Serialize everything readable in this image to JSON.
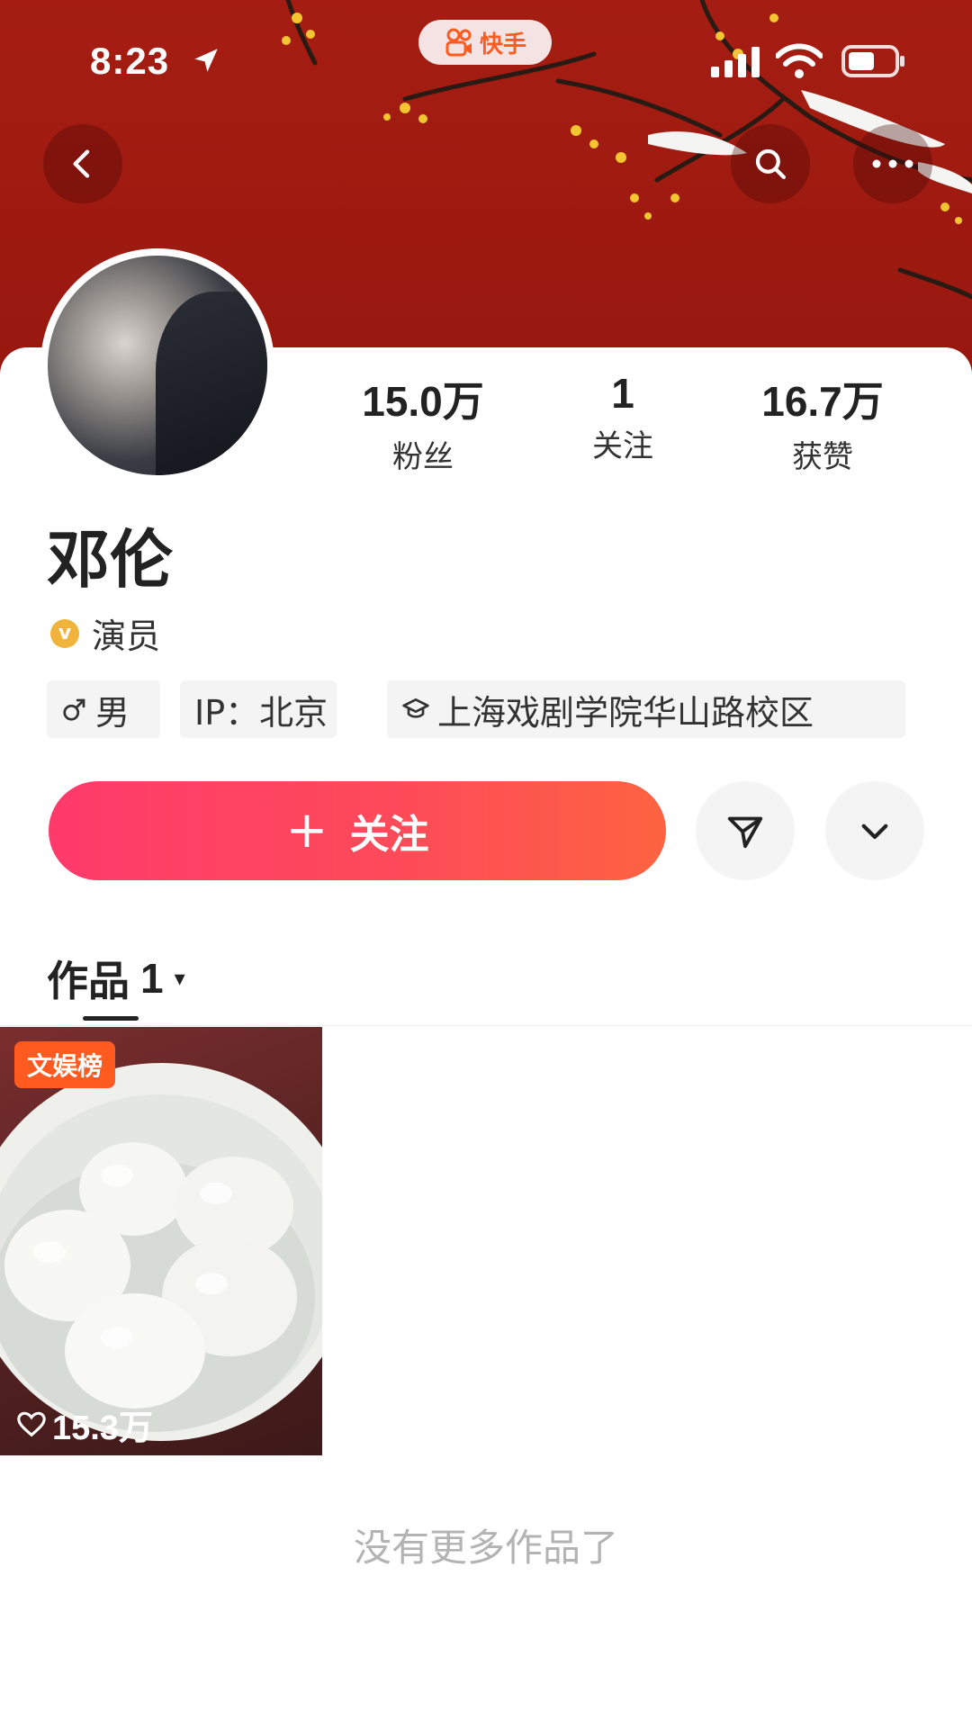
{
  "status_bar": {
    "time": "8:23",
    "app_name": "快手"
  },
  "header": {
    "icons": [
      "back-icon",
      "search-icon",
      "more-icon"
    ]
  },
  "profile": {
    "name": "邓伦",
    "verification_label": "演员",
    "verification_badge": "v",
    "stats": [
      {
        "value": "15.0万",
        "label": "粉丝"
      },
      {
        "value": "1",
        "label": "关注"
      },
      {
        "value": "16.7万",
        "label": "获赞"
      }
    ],
    "tags": {
      "gender": "男",
      "ip": "IP：北京",
      "school": "上海戏剧学院华山路校区"
    }
  },
  "actions": {
    "follow_plus": "+",
    "follow_label": "关注"
  },
  "works_tab": {
    "label": "作品",
    "count": "1",
    "caret": "▾"
  },
  "works": [
    {
      "badge": "文娱榜",
      "likes": "15.3万"
    }
  ],
  "footer_text": "没有更多作品了",
  "colors": {
    "banner_red": "#a51d12",
    "follow_gradient_start": "#fe3a6b",
    "follow_gradient_end": "#fd6340",
    "badge_orange": "#ff5a1f",
    "verify_gold": "#f0b43c"
  }
}
